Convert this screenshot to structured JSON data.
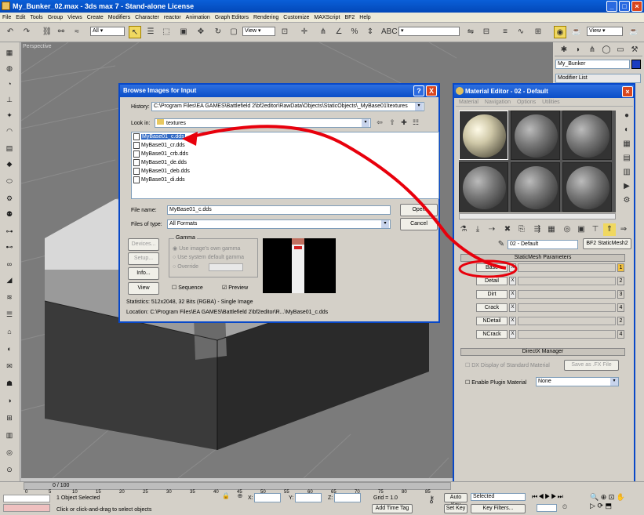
{
  "app": {
    "title": "My_Bunker_02.max - 3ds max 7 - Stand-alone License"
  },
  "menu": [
    "File",
    "Edit",
    "Tools",
    "Group",
    "Views",
    "Create",
    "Modifiers",
    "Character",
    "reactor",
    "Animation",
    "Graph Editors",
    "Rendering",
    "Customize",
    "MAXScript",
    "BF2",
    "Help"
  ],
  "toolbar": {
    "selection_filter": "All",
    "ref_coord": "View",
    "right_view": "View"
  },
  "viewport": {
    "label": "Perspective"
  },
  "right_panel": {
    "object_name": "My_Bunker",
    "modifier_list": "Modifier List"
  },
  "browse_dialog": {
    "title": "Browse Images for Input",
    "help_btn": "?",
    "close_btn": "X",
    "history_label": "History:",
    "history_value": "C:\\Program Files\\EA GAMES\\Battlefield 2\\bf2editor\\RawData\\Objects\\StaticObjects\\_MyBase01\\textures",
    "lookin_label": "Look in:",
    "lookin_value": "textures",
    "files": [
      "MyBase01_c.dds",
      "MyBase01_cr.dds",
      "MyBase01_crb.dds",
      "MyBase01_de.dds",
      "MyBase01_deb.dds",
      "MyBase01_di.dds"
    ],
    "filename_label": "File name:",
    "filename_value": "MyBase01_c.dds",
    "filetype_label": "Files of type:",
    "filetype_value": "All Formats",
    "open_btn": "Open",
    "cancel_btn": "Cancel",
    "devices_btn": "Devices...",
    "setup_btn": "Setup...",
    "info_btn": "Info...",
    "view_btn": "View",
    "gamma_label": "Gamma",
    "gamma_opt1": "Use image's own gamma",
    "gamma_opt2": "Use system default gamma",
    "gamma_opt3": "Override",
    "sequence_label": "Sequence",
    "preview_label": "Preview",
    "statistics": "Statistics:  512x2048, 32 Bits (RGBA) - Single Image",
    "location": "Location:  C:\\Program Files\\EA GAMES\\Battlefield 2\\bf2editor\\R...\\MyBase01_c.dds"
  },
  "material_editor": {
    "title": "Material Editor - 02 - Default",
    "menu": [
      "Material",
      "Navigation",
      "Options",
      "Utilities"
    ],
    "material_name": "02 - Default",
    "shader_btn": "BF2 StaticMesh2",
    "rollout1": "StaticMesh Parameters",
    "maps": [
      {
        "label": "Base",
        "num": "1"
      },
      {
        "label": "Detail",
        "num": "2"
      },
      {
        "label": "Dirt",
        "num": "3"
      },
      {
        "label": "Crack",
        "num": "4"
      },
      {
        "label": "NDetail",
        "num": "2"
      },
      {
        "label": "NCrack",
        "num": "4"
      }
    ],
    "map_x": "X",
    "rollout2": "DirectX Manager",
    "dx_display": "DX Display of Standard Material",
    "save_fx": "Save as .FX File",
    "enable_plugin": "Enable Plugin Material",
    "plugin_value": "None"
  },
  "status": {
    "frame": "0 / 100",
    "ticks": [
      "0",
      "5",
      "10",
      "15",
      "20",
      "25",
      "30",
      "35",
      "40",
      "45",
      "50",
      "55",
      "60",
      "65",
      "70",
      "75",
      "80",
      "85"
    ],
    "selected": "1 Object Selected",
    "prompt": "Click or click-and-drag to select objects",
    "x_label": "X:",
    "y_label": "Y:",
    "z_label": "Z:",
    "grid": "Grid = 1.0",
    "add_time_tag": "Add Time Tag",
    "auto_key": "Auto Key",
    "set_key": "Set Key",
    "selected_dd": "Selected",
    "key_filters": "Key Filters..."
  },
  "colors": {
    "title_blue": "#0a5fd8",
    "highlight": "#316ac5",
    "annotation_red": "#e8000c",
    "viewport": "#7b7b7b"
  }
}
